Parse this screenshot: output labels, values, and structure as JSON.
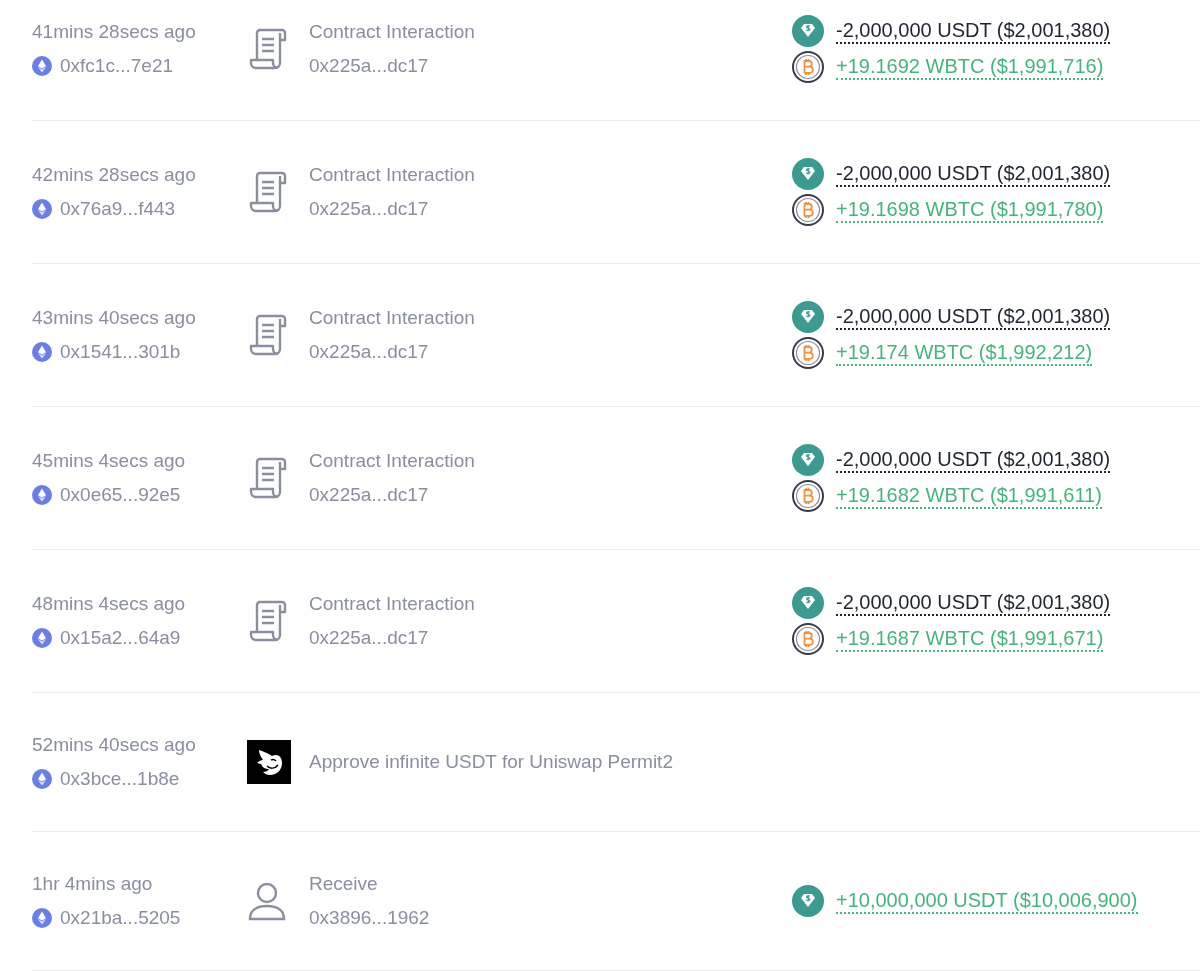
{
  "transactions": [
    {
      "time": "41mins 28secs ago",
      "hash": "0xfc1c...7e21",
      "kind": "contract",
      "title": "Contract Interaction",
      "address": "0x225a...dc17",
      "changes": [
        {
          "kind": "usdt",
          "incoming": false,
          "text": "-2,000,000 USDT ($2,001,380)"
        },
        {
          "kind": "wbtc",
          "incoming": true,
          "text": "+19.1692 WBTC ($1,991,716)"
        }
      ]
    },
    {
      "time": "42mins 28secs ago",
      "hash": "0x76a9...f443",
      "kind": "contract",
      "title": "Contract Interaction",
      "address": "0x225a...dc17",
      "changes": [
        {
          "kind": "usdt",
          "incoming": false,
          "text": "-2,000,000 USDT ($2,001,380)"
        },
        {
          "kind": "wbtc",
          "incoming": true,
          "text": "+19.1698 WBTC ($1,991,780)"
        }
      ]
    },
    {
      "time": "43mins 40secs ago",
      "hash": "0x1541...301b",
      "kind": "contract",
      "title": "Contract Interaction",
      "address": "0x225a...dc17",
      "changes": [
        {
          "kind": "usdt",
          "incoming": false,
          "text": "-2,000,000 USDT ($2,001,380)"
        },
        {
          "kind": "wbtc",
          "incoming": true,
          "text": "+19.174 WBTC ($1,992,212)"
        }
      ]
    },
    {
      "time": "45mins 4secs ago",
      "hash": "0x0e65...92e5",
      "kind": "contract",
      "title": "Contract Interaction",
      "address": "0x225a...dc17",
      "changes": [
        {
          "kind": "usdt",
          "incoming": false,
          "text": "-2,000,000 USDT ($2,001,380)"
        },
        {
          "kind": "wbtc",
          "incoming": true,
          "text": "+19.1682 WBTC ($1,991,611)"
        }
      ]
    },
    {
      "time": "48mins 4secs ago",
      "hash": "0x15a2...64a9",
      "kind": "contract",
      "title": "Contract Interaction",
      "address": "0x225a...dc17",
      "changes": [
        {
          "kind": "usdt",
          "incoming": false,
          "text": "-2,000,000 USDT ($2,001,380)"
        },
        {
          "kind": "wbtc",
          "incoming": true,
          "text": "+19.1687 WBTC ($1,991,671)"
        }
      ]
    },
    {
      "time": "52mins 40secs ago",
      "hash": "0x3bce...1b8e",
      "kind": "approve",
      "title": "Approve infinite USDT for Uniswap Permit2"
    },
    {
      "time": "1hr 4mins ago",
      "hash": "0x21ba...5205",
      "kind": "receive",
      "title": "Receive",
      "address": "0x3896...1962",
      "changes": [
        {
          "kind": "usdt",
          "incoming": true,
          "text": "+10,000,000 USDT ($10,006,900)"
        }
      ]
    }
  ]
}
